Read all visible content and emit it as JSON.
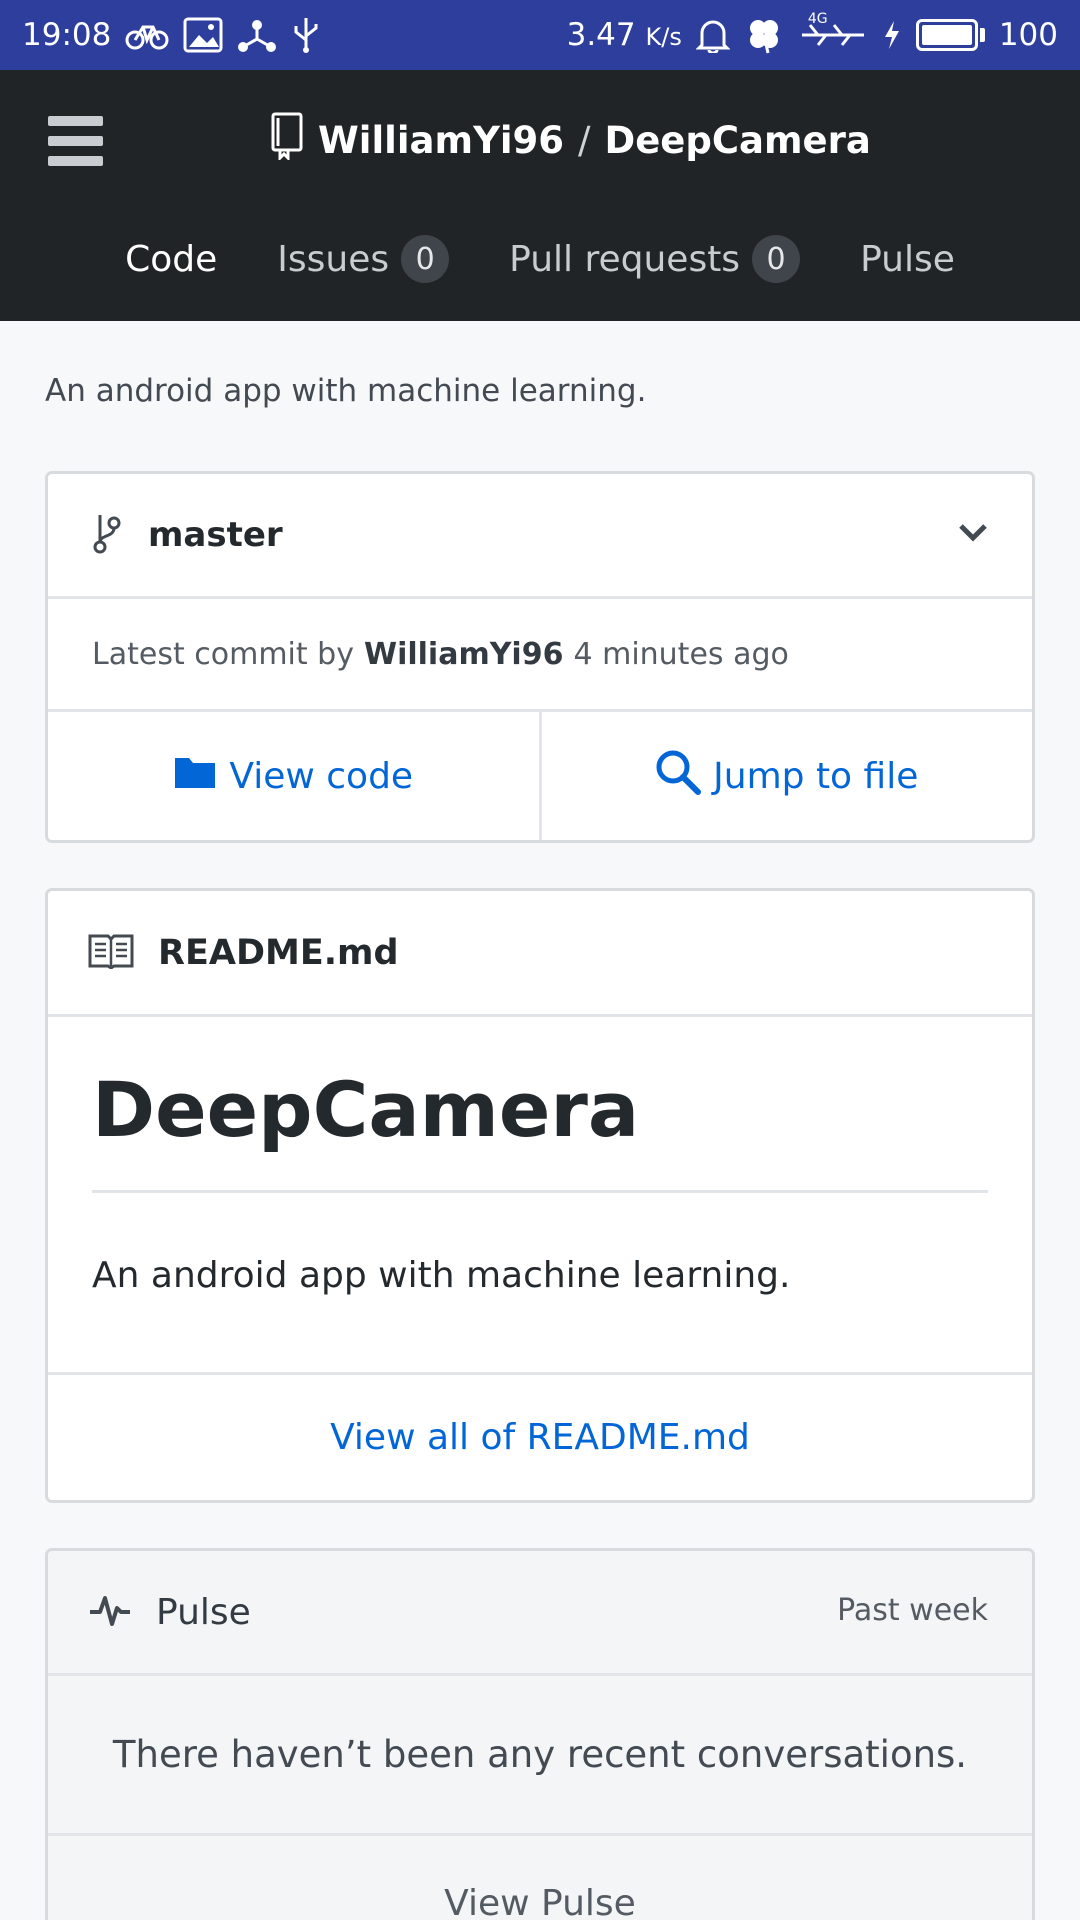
{
  "status_bar": {
    "time": "19:08",
    "net_speed": "3.47",
    "net_unit": "K/s",
    "network_type": "4G",
    "battery_level": "100",
    "icons": [
      "bike-icon",
      "image-icon",
      "share-icon",
      "usb-icon",
      "bell-icon",
      "clover-icon",
      "signal-icon",
      "charging-icon",
      "battery-icon"
    ]
  },
  "header": {
    "owner": "WilliamYi96",
    "separator": "/",
    "repo": "DeepCamera",
    "tabs": [
      {
        "label": "Code",
        "active": true
      },
      {
        "label": "Issues",
        "count": "0"
      },
      {
        "label": "Pull requests",
        "count": "0"
      },
      {
        "label": "Pulse"
      }
    ]
  },
  "description": "An android app with machine learning.",
  "branch": {
    "name": "master",
    "commit_prefix": "Latest commit by",
    "commit_author": "WilliamYi96",
    "commit_time": "4 minutes ago",
    "view_code_label": "View code",
    "jump_label": "Jump to file"
  },
  "readme": {
    "filename": "README.md",
    "heading": "DeepCamera",
    "paragraph": "An android app with machine learning.",
    "view_all_label": "View all of README.md"
  },
  "pulse": {
    "title": "Pulse",
    "range": "Past week",
    "message": "There haven’t been any recent conversations.",
    "view_label": "View Pulse"
  },
  "colors": {
    "status_bar": "#2d3e9c",
    "header": "#202427",
    "link": "#0366d6"
  }
}
